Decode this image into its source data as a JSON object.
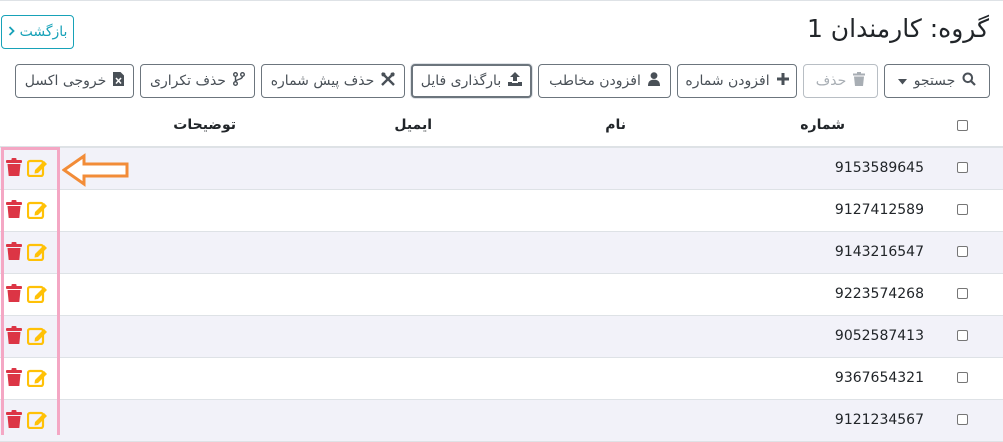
{
  "header": {
    "title": "گروه: کارمندان 1",
    "back_label": "بازگشت"
  },
  "toolbar": {
    "search_label": "جستجو",
    "delete_label": "حذف",
    "add_number_label": "افزودن شماره",
    "add_contact_label": "افزودن مخاطب",
    "upload_file_label": "بارگذاری فایل",
    "remove_prefix_label": "حذف پیش شماره",
    "remove_duplicates_label": "حذف تکراری",
    "export_excel_label": "خروجی اکسل"
  },
  "table": {
    "columns": {
      "number": "شماره",
      "name": "نام",
      "email": "ایمیل",
      "description": "توضیحات"
    },
    "rows": [
      {
        "number": "9153589645",
        "name": "",
        "email": "",
        "description": ""
      },
      {
        "number": "9127412589",
        "name": "",
        "email": "",
        "description": ""
      },
      {
        "number": "9143216547",
        "name": "",
        "email": "",
        "description": ""
      },
      {
        "number": "9223574268",
        "name": "",
        "email": "",
        "description": ""
      },
      {
        "number": "9052587413",
        "name": "",
        "email": "",
        "description": ""
      },
      {
        "number": "9367654321",
        "name": "",
        "email": "",
        "description": ""
      },
      {
        "number": "9121234567",
        "name": "",
        "email": "",
        "description": ""
      }
    ]
  },
  "colors": {
    "delete_icon": "#dc3545",
    "edit_icon": "#ffc107",
    "highlight_border": "#f4a7c4",
    "arrow": "#f28c38",
    "back_button": "#17a2b8"
  },
  "icons": {
    "search": "search-icon",
    "trash": "trash-icon",
    "plus": "plus-icon",
    "user": "user-icon",
    "upload": "upload-icon",
    "tools": "wrench-icon",
    "branch": "code-branch-icon",
    "excel": "excel-file-icon",
    "edit": "edit-icon"
  }
}
